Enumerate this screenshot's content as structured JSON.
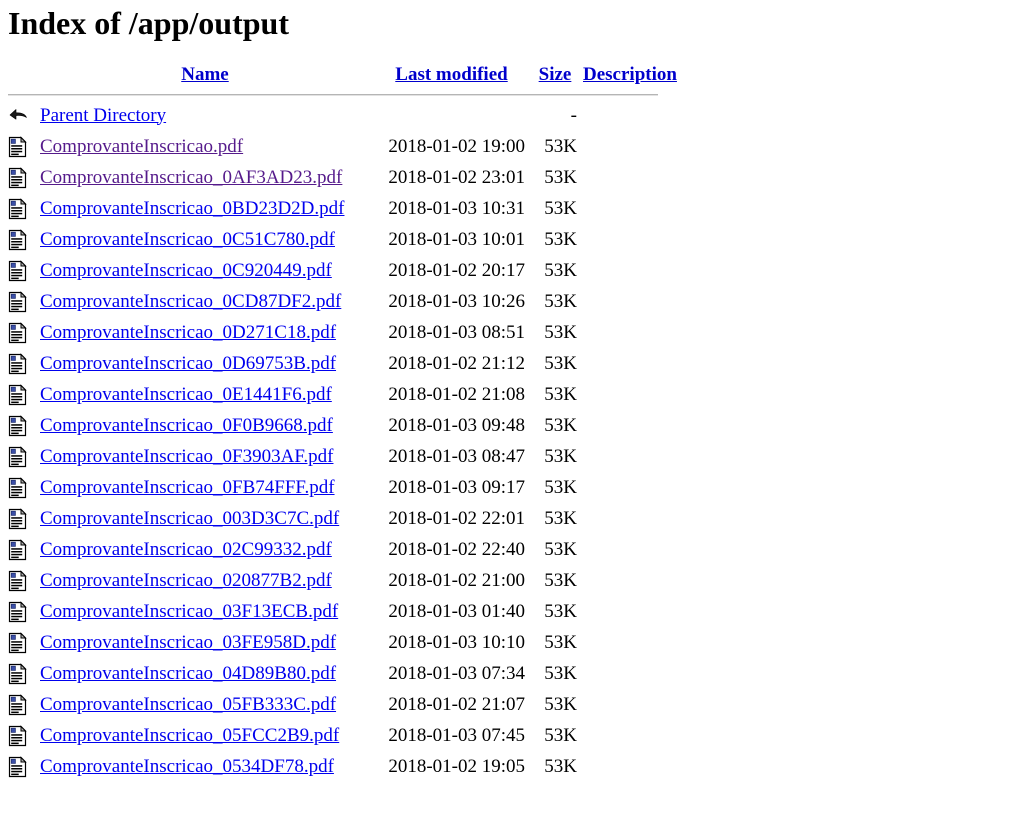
{
  "page": {
    "title": "Index of /app/output",
    "background_color": "#ffffff",
    "link_color": "#0000EE",
    "visited_link_color": "#551A8B",
    "header_link_color": "#0000CC",
    "rule_color": "#c0c0c0"
  },
  "columns": {
    "icon": "",
    "name": "Name",
    "last_modified": "Last modified",
    "size": "Size",
    "description": "Description"
  },
  "parent": {
    "icon": "back-arrow-icon",
    "name": "Parent Directory",
    "last_modified": "",
    "size": "-",
    "description": ""
  },
  "entries": [
    {
      "icon": "text-document-icon",
      "name": "ComprovanteInscricao.pdf",
      "last_modified": "2018-01-02 19:00",
      "size": "53K",
      "description": "",
      "visited": true
    },
    {
      "icon": "text-document-icon",
      "name": "ComprovanteInscricao_0AF3AD23.pdf",
      "last_modified": "2018-01-02 23:01",
      "size": "53K",
      "description": "",
      "visited": true
    },
    {
      "icon": "text-document-icon",
      "name": "ComprovanteInscricao_0BD23D2D.pdf",
      "last_modified": "2018-01-03 10:31",
      "size": "53K",
      "description": "",
      "visited": false
    },
    {
      "icon": "text-document-icon",
      "name": "ComprovanteInscricao_0C51C780.pdf",
      "last_modified": "2018-01-03 10:01",
      "size": "53K",
      "description": "",
      "visited": false
    },
    {
      "icon": "text-document-icon",
      "name": "ComprovanteInscricao_0C920449.pdf",
      "last_modified": "2018-01-02 20:17",
      "size": "53K",
      "description": "",
      "visited": false
    },
    {
      "icon": "text-document-icon",
      "name": "ComprovanteInscricao_0CD87DF2.pdf",
      "last_modified": "2018-01-03 10:26",
      "size": "53K",
      "description": "",
      "visited": false
    },
    {
      "icon": "text-document-icon",
      "name": "ComprovanteInscricao_0D271C18.pdf",
      "last_modified": "2018-01-03 08:51",
      "size": "53K",
      "description": "",
      "visited": false
    },
    {
      "icon": "text-document-icon",
      "name": "ComprovanteInscricao_0D69753B.pdf",
      "last_modified": "2018-01-02 21:12",
      "size": "53K",
      "description": "",
      "visited": false
    },
    {
      "icon": "text-document-icon",
      "name": "ComprovanteInscricao_0E1441F6.pdf",
      "last_modified": "2018-01-02 21:08",
      "size": "53K",
      "description": "",
      "visited": false
    },
    {
      "icon": "text-document-icon",
      "name": "ComprovanteInscricao_0F0B9668.pdf",
      "last_modified": "2018-01-03 09:48",
      "size": "53K",
      "description": "",
      "visited": false
    },
    {
      "icon": "text-document-icon",
      "name": "ComprovanteInscricao_0F3903AF.pdf",
      "last_modified": "2018-01-03 08:47",
      "size": "53K",
      "description": "",
      "visited": false
    },
    {
      "icon": "text-document-icon",
      "name": "ComprovanteInscricao_0FB74FFF.pdf",
      "last_modified": "2018-01-03 09:17",
      "size": "53K",
      "description": "",
      "visited": false
    },
    {
      "icon": "text-document-icon",
      "name": "ComprovanteInscricao_003D3C7C.pdf",
      "last_modified": "2018-01-02 22:01",
      "size": "53K",
      "description": "",
      "visited": false
    },
    {
      "icon": "text-document-icon",
      "name": "ComprovanteInscricao_02C99332.pdf",
      "last_modified": "2018-01-02 22:40",
      "size": "53K",
      "description": "",
      "visited": false
    },
    {
      "icon": "text-document-icon",
      "name": "ComprovanteInscricao_020877B2.pdf",
      "last_modified": "2018-01-02 21:00",
      "size": "53K",
      "description": "",
      "visited": false
    },
    {
      "icon": "text-document-icon",
      "name": "ComprovanteInscricao_03F13ECB.pdf",
      "last_modified": "2018-01-03 01:40",
      "size": "53K",
      "description": "",
      "visited": false
    },
    {
      "icon": "text-document-icon",
      "name": "ComprovanteInscricao_03FE958D.pdf",
      "last_modified": "2018-01-03 10:10",
      "size": "53K",
      "description": "",
      "visited": false
    },
    {
      "icon": "text-document-icon",
      "name": "ComprovanteInscricao_04D89B80.pdf",
      "last_modified": "2018-01-03 07:34",
      "size": "53K",
      "description": "",
      "visited": false
    },
    {
      "icon": "text-document-icon",
      "name": "ComprovanteInscricao_05FB333C.pdf",
      "last_modified": "2018-01-02 21:07",
      "size": "53K",
      "description": "",
      "visited": false
    },
    {
      "icon": "text-document-icon",
      "name": "ComprovanteInscricao_05FCC2B9.pdf",
      "last_modified": "2018-01-03 07:45",
      "size": "53K",
      "description": "",
      "visited": false
    },
    {
      "icon": "text-document-icon",
      "name": "ComprovanteInscricao_0534DF78.pdf",
      "last_modified": "2018-01-02 19:05",
      "size": "53K",
      "description": "",
      "visited": false
    }
  ]
}
